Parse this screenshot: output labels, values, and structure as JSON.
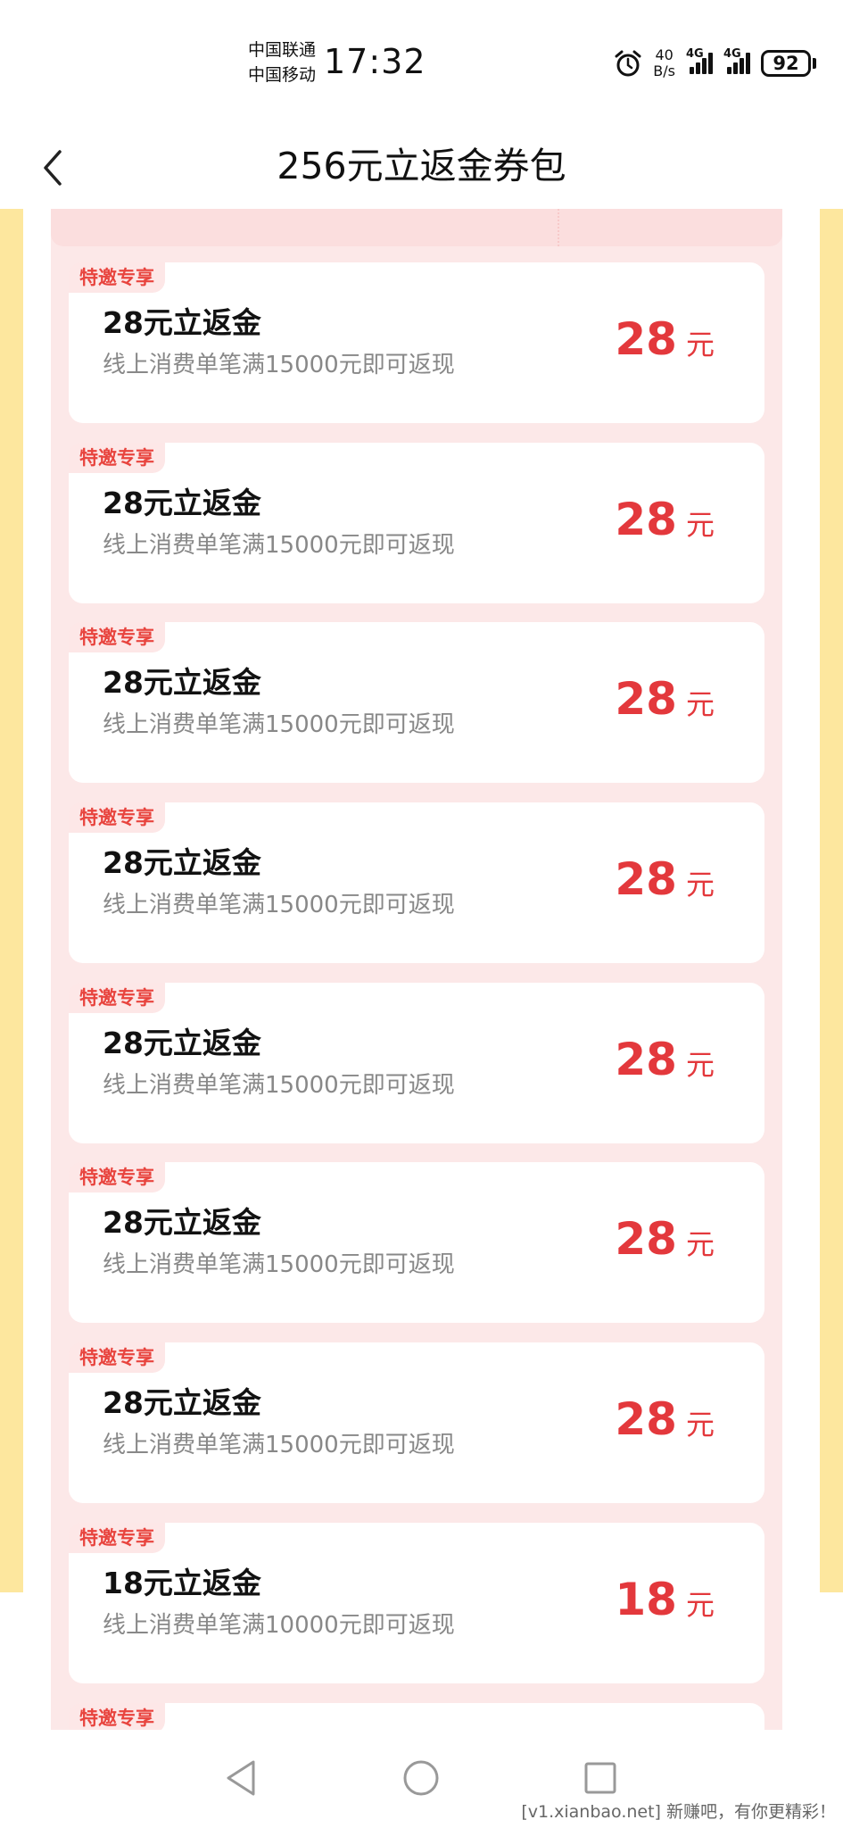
{
  "status_bar": {
    "carrier_1": "中国联通",
    "carrier_2": "中国移动",
    "time": "17:32",
    "speed_value": "40",
    "speed_unit": "B/s",
    "network_1": "4G",
    "network_2": "4G",
    "battery": "92"
  },
  "header": {
    "title": "256元立返金券包"
  },
  "coupons": [
    {
      "badge": "特邀专享",
      "title": "28元立返金",
      "desc": "线上消费单笔满15000元即可返现",
      "amount": "28",
      "unit": "元"
    },
    {
      "badge": "特邀专享",
      "title": "28元立返金",
      "desc": "线上消费单笔满15000元即可返现",
      "amount": "28",
      "unit": "元"
    },
    {
      "badge": "特邀专享",
      "title": "28元立返金",
      "desc": "线上消费单笔满15000元即可返现",
      "amount": "28",
      "unit": "元"
    },
    {
      "badge": "特邀专享",
      "title": "28元立返金",
      "desc": "线上消费单笔满15000元即可返现",
      "amount": "28",
      "unit": "元"
    },
    {
      "badge": "特邀专享",
      "title": "28元立返金",
      "desc": "线上消费单笔满15000元即可返现",
      "amount": "28",
      "unit": "元"
    },
    {
      "badge": "特邀专享",
      "title": "28元立返金",
      "desc": "线上消费单笔满15000元即可返现",
      "amount": "28",
      "unit": "元"
    },
    {
      "badge": "特邀专享",
      "title": "28元立返金",
      "desc": "线上消费单笔满15000元即可返现",
      "amount": "28",
      "unit": "元"
    },
    {
      "badge": "特邀专享",
      "title": "18元立返金",
      "desc": "线上消费单笔满10000元即可返现",
      "amount": "18",
      "unit": "元"
    },
    {
      "badge": "特邀专享",
      "title": "",
      "desc": "",
      "amount": "",
      "unit": ""
    }
  ],
  "watermark": "[v1.xianbao.net] 新赚吧，有你更精彩！",
  "colors": {
    "accent_red": "#e3383c",
    "panel_pink": "#fce8e8",
    "side_yellow": "#fde79e"
  },
  "icons": {
    "back": "chevron-left-icon",
    "alarm": "alarm-icon",
    "nav_back": "triangle-back-icon",
    "nav_home": "circle-home-icon",
    "nav_recent": "square-recent-icon"
  }
}
